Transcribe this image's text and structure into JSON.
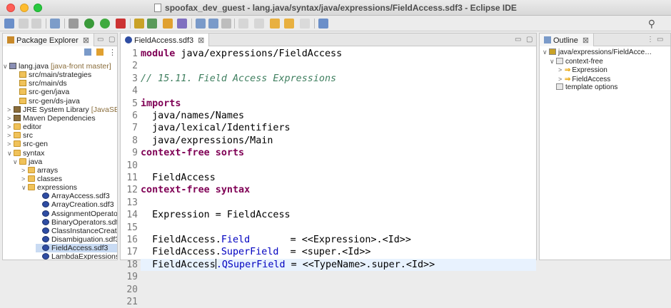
{
  "window": {
    "title": "spoofax_dev_guest - lang.java/syntax/java/expressions/FieldAccess.sdf3 - Eclipse IDE"
  },
  "package_explorer": {
    "tab_label": "Package Explorer",
    "close_glyph": "⊠",
    "items": [
      {
        "label": "lang.java",
        "suffix": "[java-front master]",
        "icon": "project-icon",
        "arrow": "∨"
      },
      {
        "label": "src/main/strategies",
        "suffix": "",
        "icon": "package-folder-icon",
        "arrow": ""
      },
      {
        "label": "src/main/ds",
        "suffix": "",
        "icon": "package-folder-icon",
        "arrow": ""
      },
      {
        "label": "src-gen/java",
        "suffix": "",
        "icon": "package-folder-icon",
        "arrow": ""
      },
      {
        "label": "src-gen/ds-java",
        "suffix": "",
        "icon": "package-folder-icon",
        "arrow": ""
      },
      {
        "label": "JRE System Library",
        "suffix": "[JavaSE-",
        "icon": "library-icon",
        "arrow": ">"
      },
      {
        "label": "Maven Dependencies",
        "suffix": "",
        "icon": "library-icon",
        "arrow": ">"
      },
      {
        "label": "editor",
        "suffix": "",
        "icon": "folder-icon",
        "arrow": ">"
      },
      {
        "label": "src",
        "suffix": "",
        "icon": "folder-icon",
        "arrow": ">"
      },
      {
        "label": "src-gen",
        "suffix": "",
        "icon": "folder-icon",
        "arrow": ">"
      },
      {
        "label": "syntax",
        "suffix": "",
        "icon": "folder-icon",
        "arrow": "∨"
      },
      {
        "label": "java",
        "suffix": "",
        "icon": "folder-icon",
        "arrow": "∨"
      },
      {
        "label": "arrays",
        "suffix": "",
        "icon": "folder-icon",
        "arrow": ">"
      },
      {
        "label": "classes",
        "suffix": "",
        "icon": "folder-icon",
        "arrow": ">"
      },
      {
        "label": "expressions",
        "suffix": "",
        "icon": "folder-icon",
        "arrow": "∨"
      },
      {
        "label": "ArrayAccess.sdf3",
        "suffix": "",
        "icon": "sdf3-file-icon",
        "arrow": ""
      },
      {
        "label": "ArrayCreation.sdf3",
        "suffix": "",
        "icon": "sdf3-file-icon",
        "arrow": ""
      },
      {
        "label": "AssignmentOperator",
        "suffix": "",
        "icon": "sdf3-file-icon",
        "arrow": ""
      },
      {
        "label": "BinaryOperators.sdf:",
        "suffix": "",
        "icon": "sdf3-file-icon",
        "arrow": ""
      },
      {
        "label": "ClassInstanceCreatic",
        "suffix": "",
        "icon": "sdf3-file-icon",
        "arrow": ""
      },
      {
        "label": "Disambiguation.sdf3",
        "suffix": "",
        "icon": "sdf3-file-icon",
        "arrow": ""
      },
      {
        "label": "FieldAccess.sdf3",
        "suffix": "",
        "icon": "sdf3-file-icon",
        "arrow": ""
      },
      {
        "label": "LambdaExpressions.",
        "suffix": "",
        "icon": "sdf3-file-icon",
        "arrow": ""
      }
    ]
  },
  "editor": {
    "tab_label": "FieldAccess.sdf3",
    "close_glyph": "⊠",
    "line_numbers": [
      "1",
      "2",
      "3",
      "4",
      "5",
      "6",
      "7",
      "8",
      "9",
      "10",
      "11",
      "12",
      "13",
      "14",
      "15",
      "16",
      "17",
      "18",
      "19",
      "20",
      "21"
    ],
    "lines": {
      "l1_kw": "module",
      "l1_rest": " java/expressions/FieldAccess",
      "l3": "// 15.11. Field Access Expressions",
      "l5": "imports",
      "l6": "  java/names/Names",
      "l7": "  java/lexical/Identifiers",
      "l8": "  java/expressions/Main",
      "l10": "context-free sorts",
      "l12": "  FieldAccess",
      "l14": "context-free syntax",
      "l16": "  Expression = FieldAccess",
      "l18_a": "  FieldAccess.",
      "l18_b": "Field",
      "l18_c": "       = <<Expression>.<Id>>",
      "l19_a": "  FieldAccess.",
      "l19_b": "SuperField",
      "l19_c": "  = <super.<Id>>",
      "l20_a": "  FieldAccess",
      "l20_b": ".QSuperField",
      "l20_c": " = <<TypeName>.super.<Id>>"
    }
  },
  "outline": {
    "tab_label": "Outline",
    "close_glyph": "⊠",
    "items": [
      {
        "label": "java/expressions/FieldAcce…",
        "arrow": "∨"
      },
      {
        "label": "context-free",
        "arrow": "∨"
      },
      {
        "label": "Expression",
        "arrow": ">"
      },
      {
        "label": "FieldAccess",
        "arrow": ">"
      },
      {
        "label": "template options",
        "arrow": ""
      }
    ]
  },
  "colors": {
    "keyword": "#7f0055",
    "comment": "#3f7f5f",
    "field": "#0000c0",
    "selection": "#c9dbf3",
    "current_line": "#e8f2fe"
  }
}
